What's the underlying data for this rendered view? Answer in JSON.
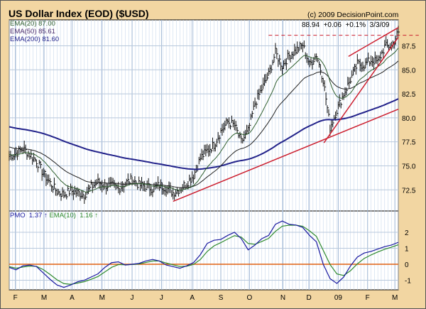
{
  "title": "US Dollar Index (EOD) ($USD)",
  "copyright": "(c) 2009 DecisionPoint.com",
  "quote": {
    "last": "88.94",
    "change": "+0.06",
    "pct": "+0.1%",
    "date": "3/3/09"
  },
  "legend": {
    "ema20": "EMA(20) 87.00",
    "ema50": "EMA(50) 85.61",
    "ema200": "EMA(200) 81.60",
    "pmo_label": "PMO",
    "pmo_value": "1.37",
    "pmo_ema_label": "EMA(10)",
    "pmo_ema_value": "1.16"
  },
  "colors": {
    "background": "#f2d6a2",
    "bars": "#111111",
    "ema20": "#2f5f2f",
    "ema50": "#222222",
    "ema200": "#22228a",
    "trend": "#cc1f2f",
    "pmo": "#1a1aa0",
    "pmo_ema": "#2e8a2e",
    "zero": "#e06010",
    "grid": "#c8d8ec"
  },
  "chart_data": [
    {
      "type": "line",
      "title": "US Dollar Index (EOD) ($USD)",
      "subtype": "price bars with EMA overlays",
      "x_unit": "week index (Feb 2008 - Mar 2009)",
      "ylim": [
        70.3,
        90.2
      ],
      "yticks": [
        72.5,
        75.0,
        77.5,
        80.0,
        82.5,
        85.0,
        87.5
      ],
      "xticks": [
        {
          "label": "F",
          "x": 0.9
        },
        {
          "label": "M",
          "x": 5.1
        },
        {
          "label": "A",
          "x": 9.2
        },
        {
          "label": "M",
          "x": 13.6
        },
        {
          "label": "J",
          "x": 18.0
        },
        {
          "label": "J",
          "x": 22.3
        },
        {
          "label": "A",
          "x": 26.8
        },
        {
          "label": "S",
          "x": 31.0
        },
        {
          "label": "O",
          "x": 35.2
        },
        {
          "label": "N",
          "x": 40.1
        },
        {
          "label": "D",
          "x": 43.9
        },
        {
          "label": "09",
          "x": 48.2
        },
        {
          "label": "F",
          "x": 52.5
        },
        {
          "label": "M",
          "x": 56.5
        }
      ],
      "weekly_close": [
        76.0,
        76.3,
        76.8,
        76.2,
        75.5,
        74.2,
        73.2,
        72.3,
        72.0,
        72.4,
        72.2,
        72.0,
        72.8,
        73.3,
        73.0,
        72.9,
        72.6,
        73.2,
        73.6,
        73.0,
        72.9,
        72.6,
        73.0,
        72.7,
        72.2,
        72.6,
        73.2,
        74.0,
        75.8,
        76.6,
        77.2,
        78.6,
        79.6,
        79.2,
        77.5,
        78.6,
        81.5,
        83.0,
        84.5,
        86.8,
        85.4,
        86.5,
        87.0,
        87.6,
        85.5,
        86.6,
        84.0,
        79.0,
        80.8,
        82.5,
        84.0,
        85.6,
        85.5,
        86.0,
        85.8,
        87.4,
        87.5,
        88.94
      ],
      "ema_seeds": {
        "ema20": 76.2,
        "ema50": 77.0,
        "ema200": 79.1
      },
      "trendlines": [
        {
          "name": "long-support",
          "from": [
            24.0,
            71.3
          ],
          "to": [
            57,
            80.9
          ]
        },
        {
          "name": "steep-support",
          "from": [
            46.1,
            77.4
          ],
          "to": [
            57,
            88.4
          ]
        },
        {
          "name": "channel-top",
          "from": [
            49.7,
            86.4
          ],
          "to": [
            57,
            89.4
          ]
        },
        {
          "name": "resistance-dashed",
          "from": [
            38,
            88.6
          ],
          "to": [
            60,
            88.6
          ],
          "dashed": true
        }
      ]
    },
    {
      "type": "line",
      "title": "PMO",
      "ylim": [
        -1.6,
        3.33
      ],
      "yticks": [
        -1,
        0,
        1,
        2
      ],
      "pmo": [
        -0.2,
        -0.35,
        -0.1,
        -0.05,
        -0.15,
        -0.55,
        -0.95,
        -1.3,
        -1.45,
        -1.3,
        -1.1,
        -1.0,
        -0.8,
        -0.6,
        -0.2,
        0.1,
        0.15,
        -0.05,
        0.0,
        0.05,
        0.2,
        0.3,
        0.2,
        -0.05,
        -0.15,
        -0.25,
        -0.1,
        0.1,
        0.6,
        1.3,
        1.5,
        1.55,
        1.8,
        2.0,
        1.6,
        0.9,
        1.2,
        1.6,
        1.8,
        2.5,
        2.7,
        2.5,
        2.45,
        2.3,
        1.8,
        1.4,
        0.0,
        -0.9,
        -1.2,
        -0.8,
        -0.1,
        0.45,
        0.7,
        0.8,
        0.95,
        1.1,
        1.2,
        1.37
      ],
      "ema10_seed": -0.1
    }
  ]
}
